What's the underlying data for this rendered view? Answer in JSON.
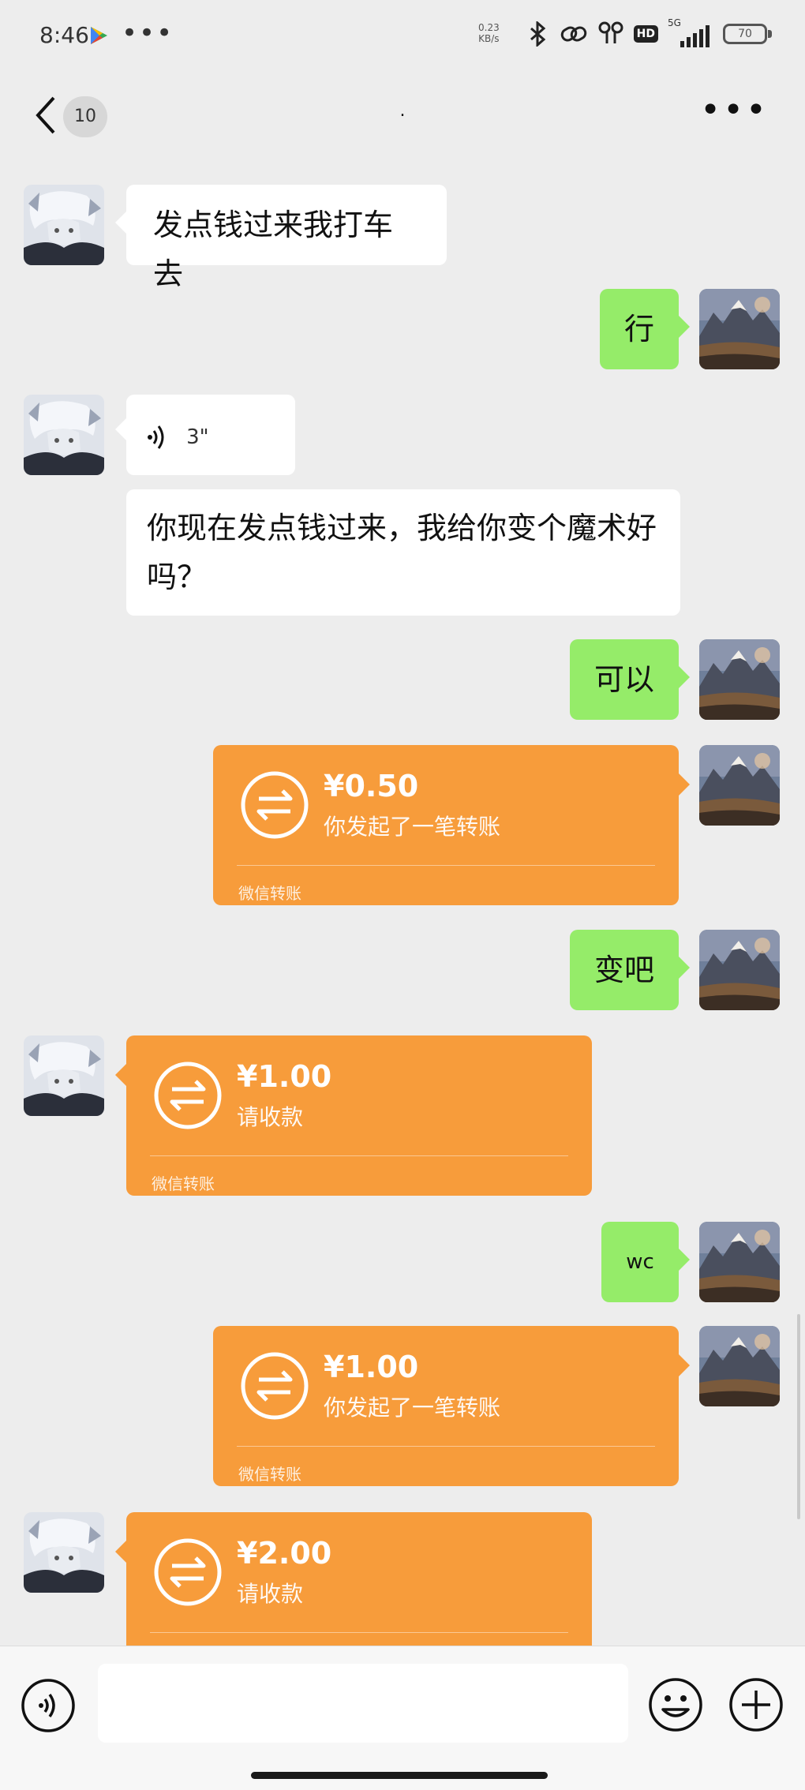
{
  "status_bar": {
    "time": "8:46",
    "more": "•••",
    "net_speed_value": "0.23",
    "net_speed_unit": "KB/s",
    "hd": "HD",
    "signal": "5G",
    "battery": "70"
  },
  "nav": {
    "unread_count": "10",
    "title": "."
  },
  "messages": [
    {
      "side": "in",
      "type": "text",
      "text": "发点钱过来我打车去"
    },
    {
      "side": "out",
      "type": "text",
      "text": "行"
    },
    {
      "side": "in",
      "type": "voice",
      "duration": "3\""
    },
    {
      "side": "in",
      "type": "text",
      "text": "你现在发点钱过来，我给你变个魔术好吗？"
    },
    {
      "side": "out",
      "type": "text",
      "text": "可以"
    },
    {
      "side": "out",
      "type": "transfer",
      "amount": "¥0.50",
      "desc": "你发起了一笔转账",
      "footer": "微信转账"
    },
    {
      "side": "out",
      "type": "text",
      "text": "变吧"
    },
    {
      "side": "in",
      "type": "transfer",
      "amount": "¥1.00",
      "desc": "请收款",
      "footer": "微信转账"
    },
    {
      "side": "out",
      "type": "text",
      "text": "wc"
    },
    {
      "side": "out",
      "type": "transfer",
      "amount": "¥1.00",
      "desc": "你发起了一笔转账",
      "footer": "微信转账"
    },
    {
      "side": "in",
      "type": "transfer",
      "amount": "¥2.00",
      "desc": "请收款",
      "footer": ""
    }
  ],
  "colors": {
    "background": "#ededed",
    "bubble_out": "#95ec69",
    "bubble_in": "#ffffff",
    "transfer": "#f79c3b"
  },
  "icons": {
    "back": "chevron-left-icon",
    "more": "more-dots-icon",
    "voice": "voice-wave-icon",
    "transfer": "transfer-arrows-icon",
    "emoji": "smiley-icon",
    "plus": "plus-circle-icon"
  }
}
